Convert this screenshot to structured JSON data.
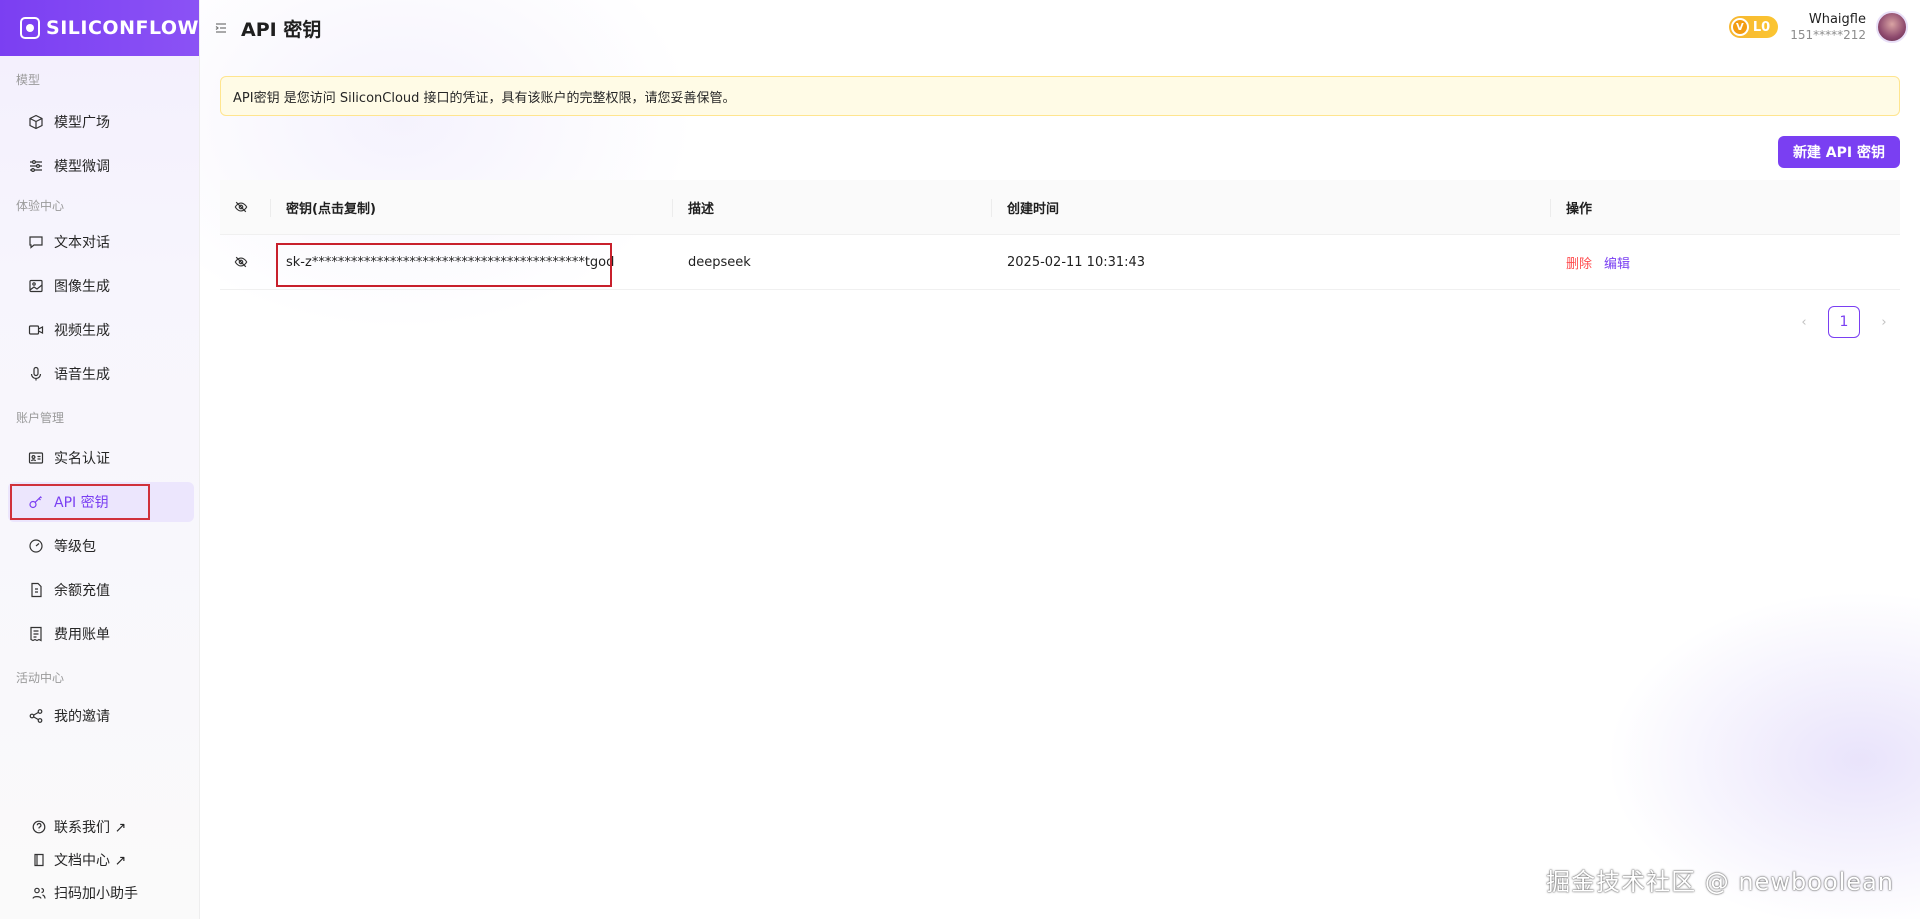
{
  "brand": {
    "logo_text": "SILICONFLOW",
    "accent": "#7a3ff2"
  },
  "sidebar": {
    "sections": [
      {
        "title": "模型",
        "items": [
          {
            "label": "模型广场",
            "icon": "cube-icon"
          },
          {
            "label": "模型微调",
            "icon": "sliders-icon"
          }
        ]
      },
      {
        "title": "体验中心",
        "items": [
          {
            "label": "文本对话",
            "icon": "chat-icon"
          },
          {
            "label": "图像生成",
            "icon": "image-icon"
          },
          {
            "label": "视频生成",
            "icon": "video-icon"
          },
          {
            "label": "语音生成",
            "icon": "mic-icon"
          }
        ]
      },
      {
        "title": "账户管理",
        "items": [
          {
            "label": "实名认证",
            "icon": "id-card-icon"
          },
          {
            "label": "API 密钥",
            "icon": "key-icon",
            "active": true
          },
          {
            "label": "等级包",
            "icon": "gauge-icon"
          },
          {
            "label": "余额充值",
            "icon": "recharge-icon"
          },
          {
            "label": "费用账单",
            "icon": "bill-icon"
          }
        ]
      },
      {
        "title": "活动中心",
        "items": [
          {
            "label": "我的邀请",
            "icon": "share-icon"
          }
        ]
      }
    ],
    "bottom": [
      {
        "label": "联系我们 ↗",
        "icon": "help-icon"
      },
      {
        "label": "文档中心 ↗",
        "icon": "book-icon"
      },
      {
        "label": "扫码加小助手",
        "icon": "users-icon"
      }
    ]
  },
  "header": {
    "title": "API 密钥",
    "level": "L0",
    "level_v": "V",
    "user_name": "Whaigfle",
    "user_phone": "151*****212"
  },
  "notice": "API密钥 是您访问 SiliconCloud 接口的凭证，具有该账户的完整权限，请您妥善保管。",
  "new_key_button": "新建 API 密钥",
  "table": {
    "headers": {
      "key": "密钥(点击复制)",
      "desc": "描述",
      "time": "创建时间",
      "action": "操作"
    },
    "rows": [
      {
        "key": "sk-z******************************************tgod",
        "desc": "deepseek",
        "time": "2025-02-11 10:31:43",
        "delete": "删除",
        "edit": "编辑"
      }
    ]
  },
  "pagination": {
    "current": "1"
  },
  "watermark": "掘金技术社区 @ newboolean"
}
